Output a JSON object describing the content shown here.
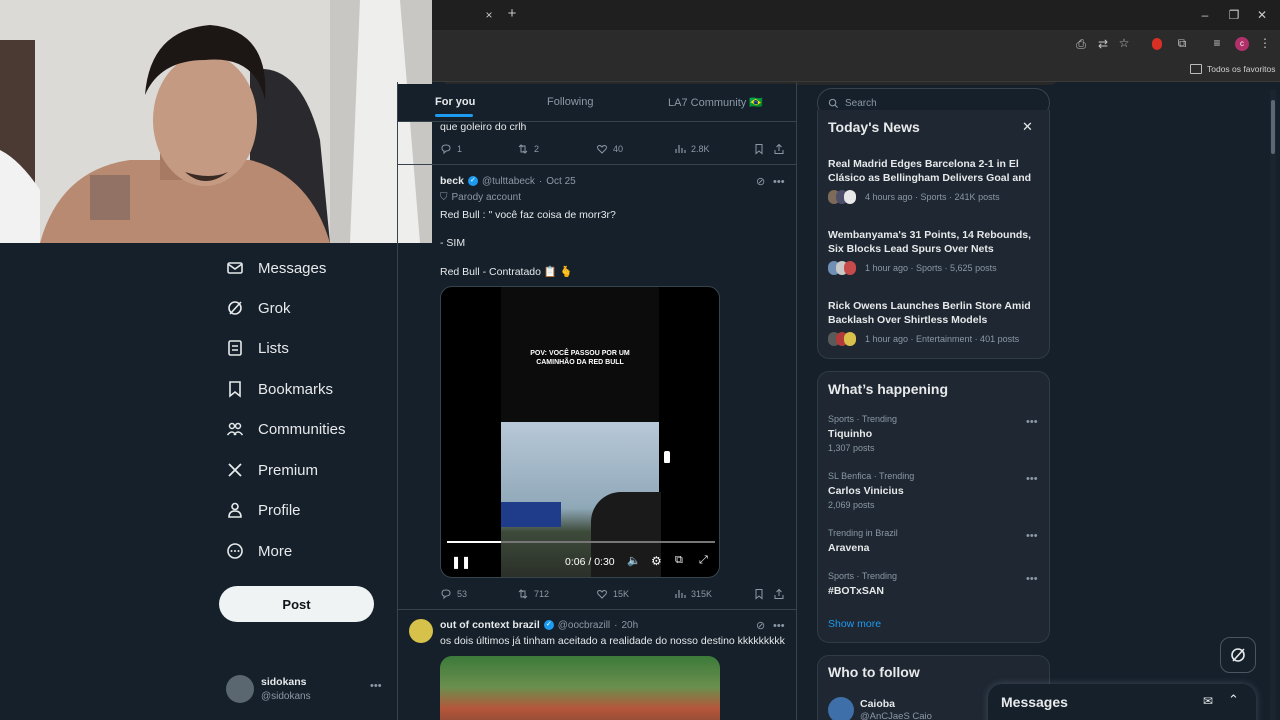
{
  "browser": {
    "bookmark_label": "Todos os favoritos",
    "profile_initial": "c",
    "tab_close": "×",
    "tab_new": "+"
  },
  "nav": {
    "items": [
      {
        "label": "Messages"
      },
      {
        "label": "Grok"
      },
      {
        "label": "Lists"
      },
      {
        "label": "Bookmarks"
      },
      {
        "label": "Communities"
      },
      {
        "label": "Premium"
      },
      {
        "label": "Profile"
      },
      {
        "label": "More"
      }
    ],
    "post_label": "Post"
  },
  "account": {
    "name": "sidokans",
    "handle": "@sidokans"
  },
  "feed": {
    "tabs": [
      {
        "label": "For you"
      },
      {
        "label": "Following"
      },
      {
        "label": "LA7 Community 🇧🇷"
      }
    ],
    "prev_tweet": {
      "text": "que goleiro do crlh",
      "replies": "1",
      "retweets": "2",
      "likes": "40",
      "views": "2.8K"
    },
    "tweet1": {
      "name": "beck",
      "handle": "@tulttabeck",
      "date": "Oct 25",
      "label": "Parody account",
      "line1": "Red Bull : \" você faz coisa de morr3r?",
      "line2": "- SIM",
      "line3": "Red Bull - Contratado 📋 🫰",
      "video_caption": "POV: VOCÊ PASSOU POR UM CAMINHÃO DA RED BULL",
      "video_time": "0:06 / 0:30",
      "video_progress": 0.2,
      "replies": "53",
      "retweets": "712",
      "likes": "15K",
      "views": "315K"
    },
    "tweet2": {
      "name": "out of context brazil",
      "handle": "@oocbrazill",
      "date": "20h",
      "text": "os dois últimos já tinham aceitado a realidade do nosso destino kkkkkkkkk"
    }
  },
  "search": {
    "placeholder": "Search"
  },
  "news": {
    "title": "Today's News",
    "items": [
      {
        "headline": "Real Madrid Edges Barcelona 2-1 in El Clásico as Bellingham Delivers Goal and ...",
        "meta": "4 hours ago · Sports · 241K posts"
      },
      {
        "headline": "Wembanyama's 31 Points, 14 Rebounds, Six Blocks Lead Spurs Over Nets",
        "meta": "1 hour ago · Sports · 5,625 posts"
      },
      {
        "headline": "Rick Owens Launches Berlin Store Amid Backlash Over Shirtless Models",
        "meta": "1 hour ago · Entertainment · 401 posts"
      }
    ]
  },
  "happening": {
    "title": "What’s happening",
    "items": [
      {
        "context": "Sports · Trending",
        "topic": "Tiquinho",
        "count": "1,307 posts"
      },
      {
        "context": "SL Benfica · Trending",
        "topic": "Carlos Vinicius",
        "count": "2,069 posts"
      },
      {
        "context": "Trending in Brazil",
        "topic": "Aravena",
        "count": ""
      },
      {
        "context": "Sports · Trending",
        "topic": "#BOTxSAN",
        "count": ""
      }
    ],
    "show_more": "Show more"
  },
  "follow": {
    "title": "Who to follow",
    "name": "Caioba",
    "handle": "@AnCJaeS Caio"
  },
  "messages": {
    "title": "Messages"
  },
  "colors": {
    "bg": "#15202b",
    "accent": "#1d9bf0",
    "card": "#1e2732"
  }
}
